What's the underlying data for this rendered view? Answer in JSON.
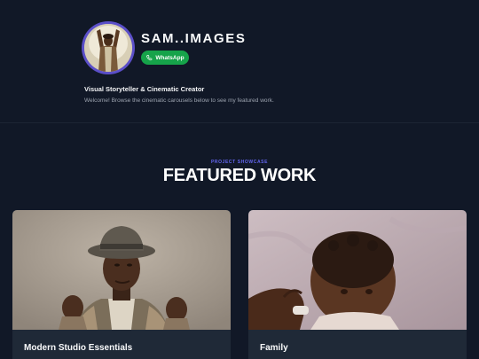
{
  "profile": {
    "name": "SAM..IMAGES",
    "whatsapp_label": "WhatsApp",
    "tagline": "Visual Storyteller & Cinematic Creator",
    "welcome": "Welcome! Browse the cinematic carousels below to see my featured work."
  },
  "showcase": {
    "eyebrow": "PROJECT SHOWCASE",
    "title": "FEATURED WORK",
    "projects": [
      {
        "title": "Modern Studio Essentials"
      },
      {
        "title": "Family"
      }
    ]
  },
  "colors": {
    "background": "#111827",
    "card": "#1f2937",
    "accent": "#6366f1",
    "avatar_ring": "#5b4fc9",
    "whatsapp": "#16a34a"
  },
  "icons": {
    "whatsapp": "whatsapp-icon"
  }
}
